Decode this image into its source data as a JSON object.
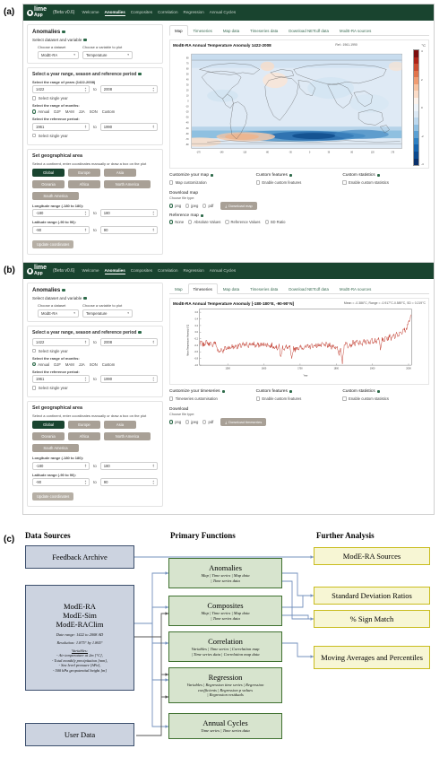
{
  "panels": {
    "a": "(a)",
    "b": "(b)",
    "c": "(c)"
  },
  "app": {
    "logo_line1": "lime",
    "logo_line2": "App",
    "version": "(Beta v0.6)",
    "nav_items": [
      {
        "label": "Welcome",
        "active": false
      },
      {
        "label": "Anomalies",
        "active": true
      },
      {
        "label": "Composites",
        "active": false
      },
      {
        "label": "Correlation",
        "active": false
      },
      {
        "label": "Regression",
        "active": false
      },
      {
        "label": "Annual Cycles",
        "active": false
      }
    ],
    "nav_accent": "#19442f"
  },
  "sidebar": {
    "title": "Anomalies",
    "section_dataset": {
      "heading": "Select dataset and variable",
      "dataset_label": "Choose a dataset",
      "dataset_value": "ModE-RA",
      "variable_label": "Choose a variable to plot",
      "variable_value": "Temperature"
    },
    "section_period": {
      "heading": "Select a year range, season and reference period",
      "years_label": "Select the range of years (1422-2008)",
      "year_from": "1422",
      "year_to": "2008",
      "to": "to",
      "single_year": "Select single year",
      "months_label": "Select the range of months:",
      "month_options": [
        "Annual",
        "DJF",
        "MAM",
        "JJA",
        "SON",
        "Custom"
      ],
      "month_selected": "Annual",
      "reference_label": "Select the reference period:",
      "ref_from": "1961",
      "ref_to": "1990",
      "single_ref_year": "Select single year"
    },
    "section_area": {
      "heading": "Set geographical area",
      "subheading": "Select a continent, enter coordinates manually or draw a box on the plot",
      "continents": [
        "Global",
        "Europe",
        "Asia",
        "Oceania",
        "Africa",
        "North America",
        "South America"
      ],
      "continent_selected": "Global",
      "lon_label": "Longitude range (-180 to 180):",
      "lon_from": "-180",
      "lon_to": "180",
      "lat_label": "Latitude range (-90 to 90):",
      "lat_from": "-90",
      "lat_to": "90",
      "to": "to",
      "update_button": "Update coordinates"
    }
  },
  "main_tabs": [
    "Map",
    "Timeseries",
    "Map data",
    "Timeseries data",
    "Download NETcdf data",
    "ModE-RA sources"
  ],
  "panel_a": {
    "active_tab": "Map",
    "plot_title": "ModE-RA Annual Temperature Anomaly 1422-2008",
    "plot_meta": "Ref.: 1961-1990",
    "unit": "°C",
    "options": [
      {
        "title": "Customize your map",
        "checkbox": "Map customization"
      },
      {
        "title": "Custom features",
        "checkbox": "Enable custom features"
      },
      {
        "title": "Custom statistics",
        "checkbox": "Enable custom statistics"
      }
    ],
    "download_heading": "Download map",
    "download_sub": "Choose file type:",
    "file_types": [
      "png",
      "jpeg",
      "pdf"
    ],
    "file_type_selected": "png",
    "download_button": "Download map",
    "reference_map_heading": "Reference map",
    "reference_map_options": [
      "None",
      "Absolute Values",
      "Reference Values",
      "SD Ratio"
    ],
    "reference_map_selected": "None"
  },
  "panel_b": {
    "active_tab": "Timeseries",
    "plot_title": "ModE-RA Annual Temperature Anomaly [-180-180°E, -90-90°N]",
    "plot_meta": "Mean = -0.386°C, Range = -0.917°C-0.589°C, SD = 0.219°C",
    "options": [
      {
        "title": "Customize your timeseries",
        "checkbox": "Timeseries customisation"
      },
      {
        "title": "Custom features",
        "checkbox": "Enable custom features"
      },
      {
        "title": "Custom statistics",
        "checkbox": "Enable custom statistics"
      }
    ],
    "download_heading": "Download",
    "download_sub": "Choose file type:",
    "file_types": [
      "png",
      "jpeg",
      "pdf"
    ],
    "file_type_selected": "png",
    "download_button": "Download timeseries"
  },
  "chart_data": [
    {
      "type": "heatmap",
      "title": "ModE-RA Annual Temperature Anomaly 1422-2008",
      "subtitle": "Ref.: 1961-1990",
      "xlabel": "",
      "ylabel": "",
      "unit": "°C",
      "xlim": [
        -180,
        180
      ],
      "ylim": [
        -90,
        90
      ],
      "xticks": [
        -170,
        -160,
        -150,
        -140,
        -130,
        -120,
        -110,
        -100,
        -90,
        -80,
        -70,
        -60,
        -50,
        -40,
        -30,
        -20,
        -10,
        0,
        10,
        20,
        30,
        40,
        50,
        60,
        70,
        80,
        90,
        100,
        110,
        120,
        130,
        140,
        150,
        160,
        170
      ],
      "yticks": [
        -80,
        -70,
        -60,
        -50,
        -40,
        -30,
        -20,
        -10,
        0,
        10,
        20,
        30,
        40,
        50,
        60,
        70,
        80
      ],
      "colorbar": {
        "ticks": [
          -4,
          -2,
          0,
          2,
          4
        ],
        "range": [
          -4.5,
          4.5
        ],
        "colors": [
          "#08306b",
          "#0b4a8f",
          "#1563ad",
          "#2e80c2",
          "#5aa0d4",
          "#8fc0e3",
          "#bcd8ee",
          "#dce9f5",
          "#eef4fa",
          "#fdf3ec",
          "#fbdcc8",
          "#f8c3a1",
          "#f09c72",
          "#e2744b",
          "#cc4c30",
          "#ae2318",
          "#7c0d0d"
        ]
      },
      "notes": "Global map; predominantly slight negative (light blue) anomaly, strong negative band over Southern Ocean (55S-70S), mild positive (orange) patches over South Atlantic/south Pacific at ~50S and North Atlantic."
    },
    {
      "type": "line",
      "title": "ModE-RA Annual Temperature Anomaly [-180-180°E, -90-90°N]",
      "subtitle": "Mean = -0.386°C, Range = -0.917°C-0.589°C, SD = 0.219°C",
      "xlabel": "Year",
      "ylabel": "Mean Temperature Anomaly [°C]",
      "series_name": "Temperature anomaly",
      "color": "#c0392b",
      "xlim": [
        1422,
        2008
      ],
      "ylim": [
        -1.0,
        0.7
      ],
      "xticks": [
        1500,
        1600,
        1700,
        1800,
        1900,
        2000
      ],
      "yticks": [
        -1.0,
        -0.8,
        -0.6,
        -0.4,
        -0.2,
        0.0,
        0.2,
        0.4,
        0.6
      ],
      "x": [
        1422,
        1427,
        1432,
        1437,
        1442,
        1447,
        1452,
        1457,
        1462,
        1467,
        1472,
        1477,
        1482,
        1487,
        1492,
        1497,
        1502,
        1507,
        1512,
        1517,
        1522,
        1527,
        1532,
        1537,
        1542,
        1547,
        1552,
        1557,
        1562,
        1567,
        1572,
        1577,
        1582,
        1587,
        1592,
        1597,
        1602,
        1607,
        1612,
        1617,
        1622,
        1627,
        1632,
        1637,
        1642,
        1647,
        1652,
        1657,
        1662,
        1667,
        1672,
        1677,
        1682,
        1687,
        1692,
        1697,
        1702,
        1707,
        1712,
        1717,
        1722,
        1727,
        1732,
        1737,
        1742,
        1747,
        1752,
        1757,
        1762,
        1767,
        1772,
        1777,
        1782,
        1787,
        1792,
        1797,
        1802,
        1807,
        1812,
        1817,
        1822,
        1827,
        1832,
        1837,
        1842,
        1847,
        1852,
        1857,
        1862,
        1867,
        1872,
        1877,
        1882,
        1887,
        1892,
        1897,
        1902,
        1907,
        1912,
        1917,
        1922,
        1927,
        1932,
        1937,
        1942,
        1947,
        1952,
        1957,
        1962,
        1967,
        1972,
        1977,
        1982,
        1987,
        1992,
        1997,
        2002,
        2008
      ],
      "values": [
        -0.36,
        -0.3,
        -0.4,
        -0.34,
        -0.28,
        -0.38,
        -0.32,
        -0.42,
        -0.3,
        -0.36,
        -0.55,
        -0.62,
        -0.5,
        -0.58,
        -0.46,
        -0.52,
        -0.44,
        -0.5,
        -0.42,
        -0.48,
        -0.4,
        -0.46,
        -0.38,
        -0.44,
        -0.36,
        -0.43,
        -0.35,
        -0.42,
        -0.34,
        -0.4,
        -0.33,
        -0.44,
        -0.36,
        -0.42,
        -0.35,
        -0.41,
        -0.34,
        -0.4,
        -0.36,
        -0.45,
        -0.38,
        -0.48,
        -0.4,
        -0.5,
        -0.42,
        -0.78,
        -0.44,
        -0.52,
        -0.43,
        -0.5,
        -0.45,
        -0.86,
        -0.46,
        -0.54,
        -0.44,
        -0.52,
        -0.43,
        -0.5,
        -0.42,
        -0.48,
        -0.4,
        -0.47,
        -0.38,
        -0.45,
        -0.37,
        -0.44,
        -0.36,
        -0.43,
        -0.35,
        -0.42,
        -0.36,
        -0.44,
        -0.38,
        -0.46,
        -0.4,
        -0.48,
        -0.42,
        -0.72,
        -0.46,
        -0.92,
        -0.4,
        -0.3,
        -0.44,
        -0.34,
        -0.42,
        -0.28,
        -0.38,
        -0.26,
        -0.36,
        -0.3,
        -0.4,
        -0.24,
        -0.34,
        -0.26,
        -0.36,
        -0.2,
        -0.3,
        -0.22,
        -0.32,
        -0.18,
        -0.48,
        -0.22,
        -0.28,
        -0.14,
        -0.24,
        -0.1,
        -0.2,
        -0.06,
        -0.16,
        -0.02,
        -0.12,
        0.04,
        -0.04,
        0.1,
        0.02,
        0.22,
        0.34,
        0.52
      ]
    }
  ],
  "diagram": {
    "columns": [
      "Data Sources",
      "Primary Functions",
      "Further Analysis"
    ],
    "sources": [
      {
        "title": "Feedback Archive",
        "lines": []
      },
      {
        "title": "ModE-RA\nModE-Sim\nModE-RAClim",
        "lines": [
          "Date range: 1422 to 2008 AD",
          "Resolution: 1.875° by 1.865°",
          "Variables:",
          "- Air temperature at 2m [°C],",
          "- Total monthly precipitation [mm],",
          "- Sea level pressure [hPa],",
          "- 500 hPa geopotential height [m]"
        ]
      },
      {
        "title": "User Data",
        "lines": []
      }
    ],
    "functions": [
      {
        "title": "Anomalies",
        "sub": "Map | Time series | Map data\n| Time series data"
      },
      {
        "title": "Composites",
        "sub": "Map | Time series | Map data\n| Time series data"
      },
      {
        "title": "Correlation",
        "sub": "Variables | Time series | Correlation map\n| Time series data | Correlation map data"
      },
      {
        "title": "Regression",
        "sub": "Variables | Regression time series | Regression\ncoefficients | Regression p values\n| Regression residuals"
      },
      {
        "title": "Annual Cycles",
        "sub": "Time series | Time series data"
      }
    ],
    "analysis": [
      "ModE-RA Sources",
      "Standard Deviation Ratios",
      "% Sign Match",
      "Moving Averages and Percentiles"
    ],
    "colors": {
      "source_fill": "#ccd3e0",
      "source_border": "#3c4f6d",
      "function_fill": "#d7e4ce",
      "function_border": "#3f7130",
      "analysis_fill": "#f7f6d4",
      "analysis_border": "#c9bc1e"
    }
  }
}
